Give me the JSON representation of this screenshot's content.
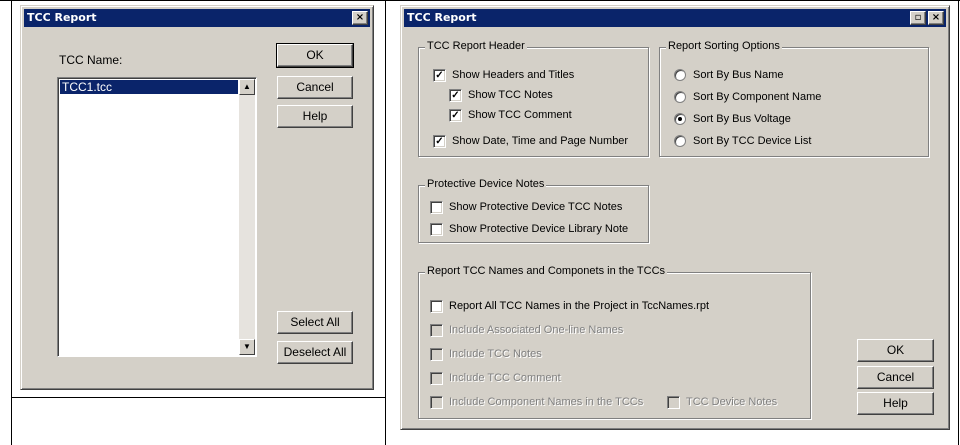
{
  "left_dialog": {
    "title": "TCC Report",
    "close_glyph": "×",
    "name_label": "TCC Name:",
    "list_items": [
      "TCC1.tcc"
    ],
    "buttons": {
      "ok": "OK",
      "cancel": "Cancel",
      "help": "Help",
      "select_all": "Select All",
      "deselect_all": "Deselect All"
    }
  },
  "right_dialog": {
    "title": "TCC Report",
    "restore_glyph": "▫",
    "close_glyph": "×",
    "header_group": {
      "title": "TCC Report Header",
      "options": [
        {
          "label": "Show Headers and Titles",
          "checked": true
        },
        {
          "label": "Show TCC Notes",
          "checked": true
        },
        {
          "label": "Show TCC Comment",
          "checked": true
        },
        {
          "label": "Show Date, Time and Page Number",
          "checked": true
        }
      ]
    },
    "sorting_group": {
      "title": "Report Sorting Options",
      "options": [
        {
          "label": "Sort By Bus Name",
          "selected": false
        },
        {
          "label": "Sort By Component Name",
          "selected": false
        },
        {
          "label": "Sort By Bus Voltage",
          "selected": true
        },
        {
          "label": "Sort By TCC Device List",
          "selected": false
        }
      ]
    },
    "protective_group": {
      "title": "Protective Device Notes",
      "options": [
        {
          "label": "Show Protective Device TCC Notes",
          "checked": false
        },
        {
          "label": "Show Protective Device Library Note",
          "checked": false
        }
      ]
    },
    "names_group": {
      "title": "Report TCC Names and Componets in the TCCs",
      "options": [
        {
          "label": "Report All TCC Names in the Project in TccNames.rpt",
          "checked": false,
          "enabled": true
        },
        {
          "label": "Include Associated One-line Names",
          "checked": false,
          "enabled": false
        },
        {
          "label": "Include TCC Notes",
          "checked": false,
          "enabled": false
        },
        {
          "label": "Include TCC Comment",
          "checked": false,
          "enabled": false
        },
        {
          "label": "Include Component Names in the TCCs",
          "checked": false,
          "enabled": false
        },
        {
          "label": "TCC Device Notes",
          "checked": false,
          "enabled": false
        }
      ]
    },
    "buttons": {
      "ok": "OK",
      "cancel": "Cancel",
      "help": "Help"
    }
  },
  "check_glyph": "✓"
}
